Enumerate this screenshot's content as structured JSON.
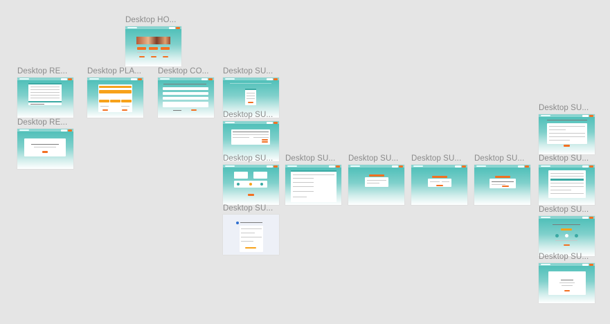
{
  "canvas": {
    "background": "#e5e5e5"
  },
  "colors": {
    "accent": "#f37021",
    "teal": "#48bdb6"
  },
  "frames": {
    "home": {
      "label": "Desktop HO..."
    },
    "re1": {
      "label": "Desktop RE..."
    },
    "re2": {
      "label": "Desktop RE..."
    },
    "pla": {
      "label": "Desktop PLA..."
    },
    "co": {
      "label": "Desktop CO..."
    },
    "su1": {
      "label": "Desktop SU..."
    },
    "su2": {
      "label": "Desktop SU..."
    },
    "su3": {
      "label": "Desktop SU..."
    },
    "su4": {
      "label": "Desktop SU..."
    },
    "su5": {
      "label": "Desktop SU..."
    },
    "su6": {
      "label": "Desktop SU..."
    },
    "su7": {
      "label": "Desktop SU..."
    },
    "su8": {
      "label": "Desktop SU..."
    },
    "su9": {
      "label": "Desktop SU..."
    },
    "su10": {
      "label": "Desktop SU..."
    },
    "su11": {
      "label": "Desktop SU..."
    },
    "su12": {
      "label": "Desktop SU..."
    }
  }
}
